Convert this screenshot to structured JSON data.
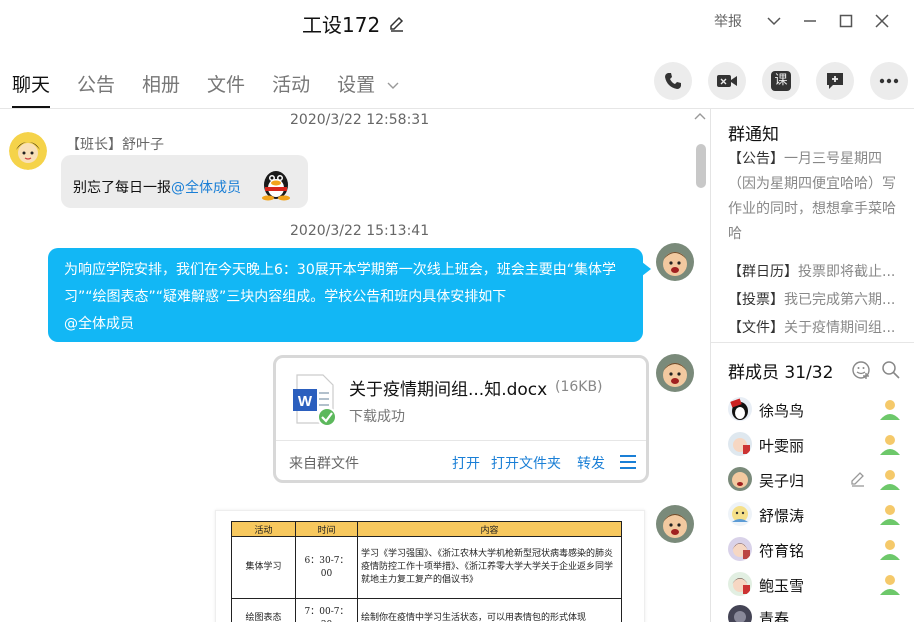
{
  "window": {
    "title": "工设172",
    "report_label": "举报"
  },
  "tabs": [
    {
      "label": "聊天",
      "active": true
    },
    {
      "label": "公告",
      "active": false
    },
    {
      "label": "相册",
      "active": false
    },
    {
      "label": "文件",
      "active": false
    },
    {
      "label": "活动",
      "active": false
    },
    {
      "label": "设置",
      "active": false
    }
  ],
  "toolbar": {
    "course_label": "课"
  },
  "chat": {
    "messages": [
      {
        "timestamp": "2020/3/22 12:58:31",
        "sender": "【班长】舒叶子",
        "text": "别忘了每日一报",
        "mention": "@全体成员"
      },
      {
        "timestamp": "2020/3/22 15:13:41",
        "text": "为响应学院安排，我们在今天晚上6：30展开本学期第一次线上班会，班会主要由“集体学习”“绘图表态”“疑难解惑”三块内容组成。学校公告和班内具体安排如下",
        "mention": "@全体成员"
      }
    ],
    "file": {
      "name": "关于疫情期间组...知.docx",
      "size": "(16KB)",
      "status": "下载成功",
      "source": "来自群文件",
      "actions": [
        "打开",
        "打开文件夹",
        "转发"
      ]
    },
    "schedule_image": {
      "headers": [
        "活动",
        "时间",
        "内容"
      ],
      "rows": [
        {
          "activity": "集体学习",
          "time": "6：30-7：00",
          "content": "学习《学习强国》、《浙江农林大学机枪新型冠状病毒感染的肺炎疫情防控工作十项举措》、《浙江养零大学大学关于企业返乡同学就地主力复工复产的倡议书》"
        },
        {
          "activity": "绘图表态",
          "time": "7：00-7：30",
          "content": "绘制你在疫情中学习生活状态，可以用表情包的形式体现"
        }
      ]
    }
  },
  "notice": {
    "title": "群通知",
    "main_tag": "【公告】",
    "main_text": "一月三号星期四（因为星期四便宜哈哈）写作业的同时，想想拿手菜哈哈",
    "items": [
      {
        "tag": "【群日历】",
        "text": "投票即将截止..."
      },
      {
        "tag": "【投票】",
        "text": "我已完成第六期..."
      },
      {
        "tag": "【文件】",
        "text": "关于疫情期间组..."
      }
    ]
  },
  "members": {
    "title": "群成员 31/32",
    "list": [
      {
        "name": "徐鸟鸟"
      },
      {
        "name": "叶雯丽"
      },
      {
        "name": "吴子归",
        "editable": true
      },
      {
        "name": "舒憬涛"
      },
      {
        "name": "符育铭"
      },
      {
        "name": "鲍玉雪"
      },
      {
        "name": "青春"
      }
    ]
  },
  "colors": {
    "accent": "#12b7f5",
    "link": "#1a7fd6",
    "header_yellow": "#f7c85e"
  }
}
